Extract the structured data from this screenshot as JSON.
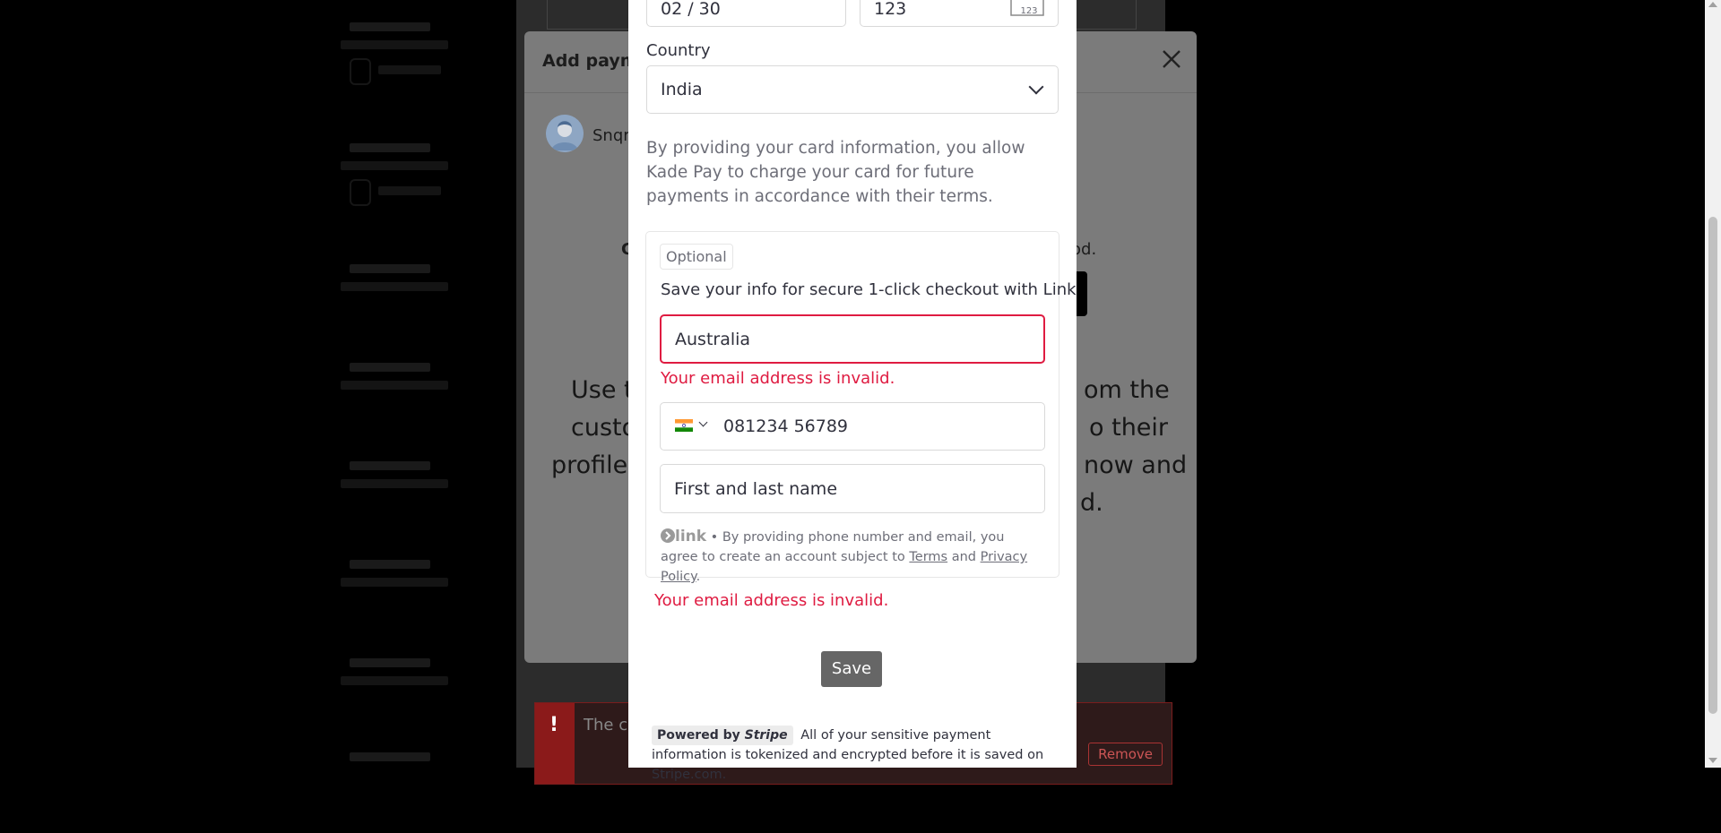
{
  "background": {
    "modal_title": "Add payme",
    "user_name": "Snqr",
    "partial_bold": "C",
    "partial_period": "od.",
    "use_lines": [
      "Use t",
      "custo",
      "profile.",
      "om the",
      "o their",
      "now and",
      "d."
    ],
    "alert_text": "The cu",
    "alert_button": "Remove"
  },
  "card": {
    "expiry_value": "02 / 30",
    "cvc_value": "123",
    "cvc_icon_label": "123"
  },
  "country": {
    "label": "Country",
    "selected": "India"
  },
  "consent_text": "By providing your card information, you allow Kade Pay to charge your card for future payments in accordance with their terms.",
  "link": {
    "optional_tag": "Optional",
    "heading": "Save your info for secure 1-click checkout with Link",
    "email_value": "Australia",
    "email_error": "Your email address is invalid.",
    "phone_placeholder": "081234 56789",
    "name_placeholder": "First and last name",
    "logo_text": "link",
    "terms_prefix": " • By providing phone number and email, you agree to create an account subject to ",
    "terms_link": "Terms",
    "terms_and": " and ",
    "privacy_link": "Privacy Policy",
    "terms_suffix": "."
  },
  "form_error": "Your email address is invalid.",
  "save_label": "Save",
  "footer": {
    "powered_prefix": "Powered by ",
    "powered_brand": "Stripe",
    "text": "All of your sensitive payment information is tokenized and encrypted before it is saved on Stripe.com."
  },
  "colors": {
    "error": "#df1b41",
    "save_button": "#666666"
  }
}
